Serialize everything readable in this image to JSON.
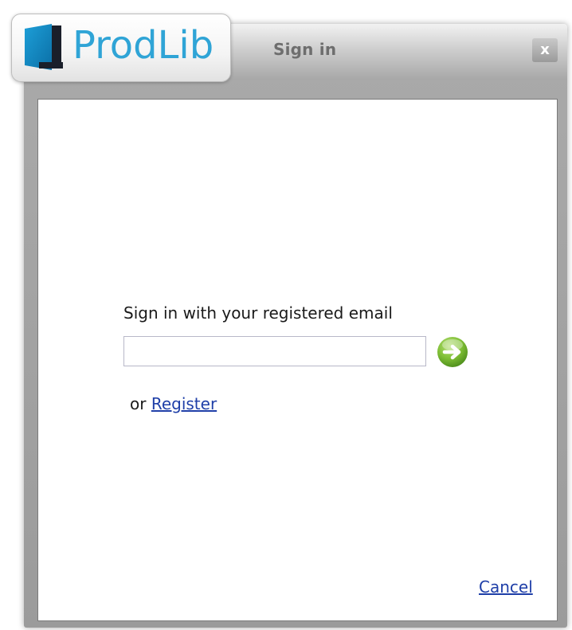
{
  "window": {
    "title": "Sign in",
    "close_label": "x"
  },
  "logo": {
    "text": "ProdLib",
    "color": "#2fa4d6",
    "icon": "door-logo-icon"
  },
  "form": {
    "prompt": "Sign in with your registered email",
    "email_value": "",
    "email_placeholder": "",
    "submit_icon": "arrow-right-circle-icon",
    "submit_color": "#6fb22e",
    "or_text": "or",
    "register_label": "Register"
  },
  "footer": {
    "cancel_label": "Cancel"
  },
  "colors": {
    "link": "#1f3fa8",
    "frame": "#a0a0a0"
  }
}
